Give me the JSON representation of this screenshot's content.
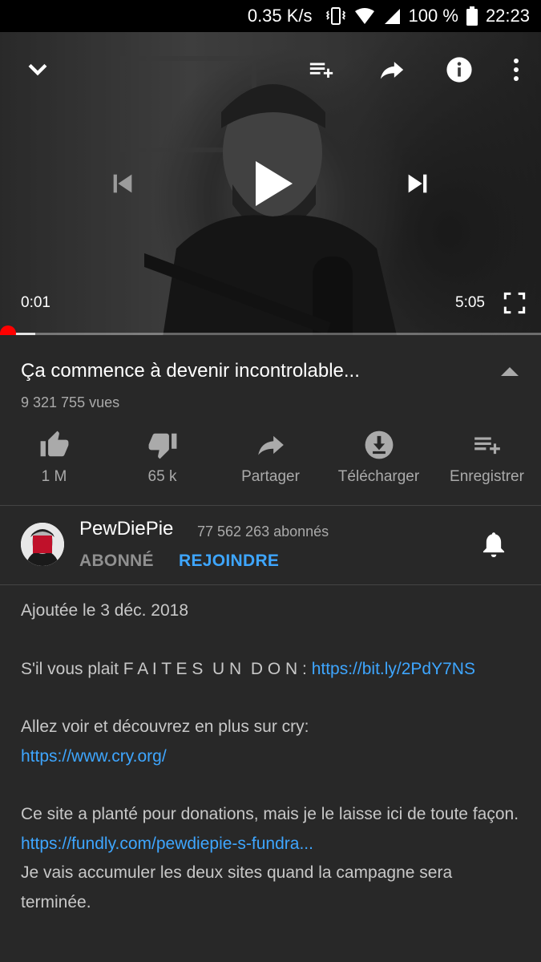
{
  "status_bar": {
    "speed": "0.35 K/s",
    "battery": "100 %",
    "time": "22:23"
  },
  "player": {
    "current_time": "0:01",
    "duration": "5:05",
    "progress_fraction": 0.003,
    "buffer_fraction": 0.065
  },
  "video": {
    "title": "Ça commence à devenir incontrolable...",
    "views": "9 321 755 vues"
  },
  "actions": [
    {
      "label": "1 M",
      "icon": "thumb-up-icon"
    },
    {
      "label": "65 k",
      "icon": "thumb-down-icon"
    },
    {
      "label": "Partager",
      "icon": "share-icon"
    },
    {
      "label": "Télécharger",
      "icon": "download-icon"
    },
    {
      "label": "Enregistrer",
      "icon": "playlist-add-icon"
    }
  ],
  "channel": {
    "name": "PewDiePie",
    "subscribers": "77 562 263 abonnés",
    "subscribed_label": "ABONNÉ",
    "join_label": "REJOINDRE"
  },
  "description": {
    "added": "Ajoutée le 3 déc. 2018",
    "donate_text": "S'il vous plait F A I T E S  U N  D O N : ",
    "donate_link": "https://bit.ly/2PdY7NS",
    "cry_text": "Allez voir et découvrez en plus sur cry:",
    "cry_link": "https://www.cry.org/",
    "crash_text": "Ce site a planté pour donations, mais je le laisse ici de toute façon.",
    "fundly_link": "https://fundly.com/pewdiepie-s-fundra...",
    "accumulate_text": "Je vais accumuler les deux sites quand la campagne sera terminée."
  },
  "colors": {
    "background": "#282828",
    "link": "#3ea6ff",
    "progress": "#ff0000"
  }
}
